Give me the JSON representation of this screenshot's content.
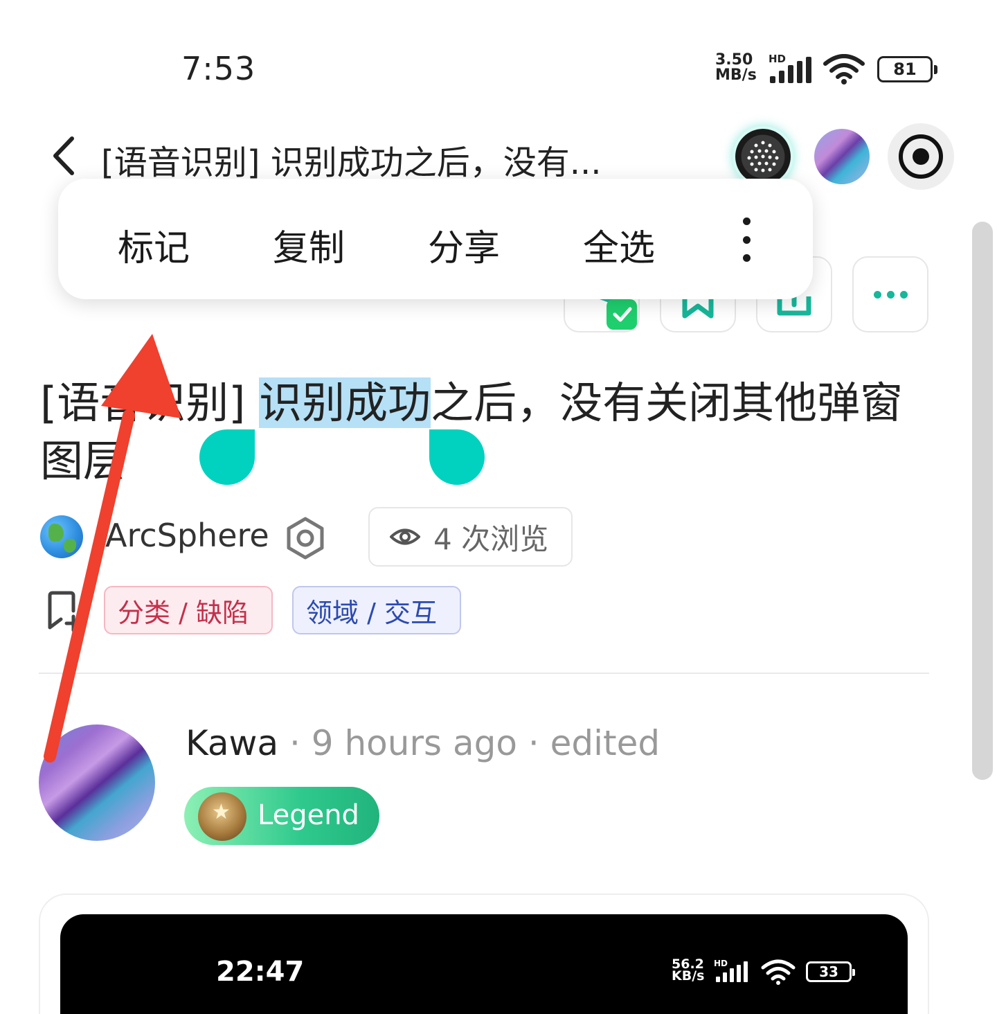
{
  "status_bar": {
    "time": "7:53",
    "net_speed": "3.50 MB/s",
    "hd": "HD",
    "battery": "81"
  },
  "header": {
    "title": "[语音识别] 识别成功之后，没有..."
  },
  "context_menu": {
    "items": [
      "标记",
      "复制",
      "分享",
      "全选"
    ]
  },
  "article": {
    "title_before": "[语音识别] ",
    "title_selected": "识别成功",
    "title_after": "之后，没有关闭其他弹窗图层"
  },
  "author": {
    "name": "ArcSphere",
    "views": "4 次浏览"
  },
  "tags": {
    "category": "分类 / 缺陷",
    "domain": "领域 / 交互"
  },
  "comment": {
    "author": "Kawa",
    "time": "9 hours ago",
    "edited": "edited",
    "badge": "Legend"
  },
  "embedded_screenshot": {
    "time": "22:47",
    "net_speed": "56.2 KB/s",
    "hd": "HD",
    "battery": "33"
  },
  "colors": {
    "accent": "#17b79a",
    "selection": "#b5e0f6",
    "handle": "#00d2bf",
    "annotation_arrow": "#f0402e"
  }
}
